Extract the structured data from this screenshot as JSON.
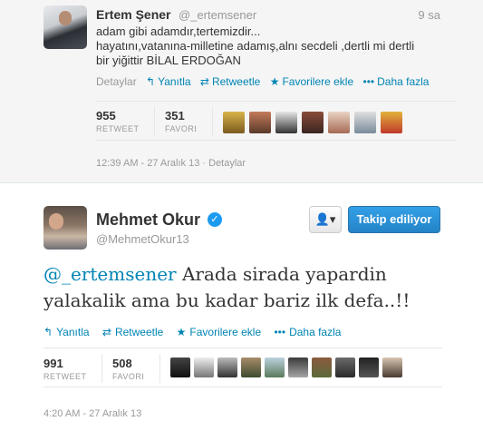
{
  "tweet1": {
    "name": "Ertem Şener",
    "handle": "@_ertemsener",
    "time": "9 sa",
    "lines": [
      "adam gibi adamdır,tertemizdir...",
      "hayatını,vatanına-milletine adamış,alnı secdeli ,dertli mi dertli",
      "bir yiğittir BİLAL ERDOĞAN"
    ],
    "actions": {
      "details": "Detaylar",
      "reply": "Yanıtla",
      "retweet": "Retweetle",
      "favorite": "Favorilere ekle",
      "more": "Daha fazla"
    },
    "retweets": {
      "count": "955",
      "label": "RETWEET"
    },
    "favorites": {
      "count": "351",
      "label": "FAVORI"
    },
    "timestamp": "12:39 AM - 27 Aralık 13 · Detaylar"
  },
  "tweet2": {
    "name": "Mehmet Okur",
    "handle": "@MehmetOkur13",
    "follow_label": "Takip ediliyor",
    "mention": "@_ertemsener",
    "text_rest": " Arada sirada yapardin",
    "text_line2": "yalakalik ama bu kadar bariz ilk defa..!!",
    "actions": {
      "reply": "Yanıtla",
      "retweet": "Retweetle",
      "favorite": "Favorilere ekle",
      "more": "Daha fazla"
    },
    "retweets": {
      "count": "991",
      "label": "RETWEET"
    },
    "favorites": {
      "count": "508",
      "label": "FAVORI"
    },
    "timestamp": "4:20 AM - 27 Aralık 13"
  },
  "colors": {
    "link": "#0084b4",
    "follow_button": "#2484c6",
    "muted": "#999999"
  }
}
